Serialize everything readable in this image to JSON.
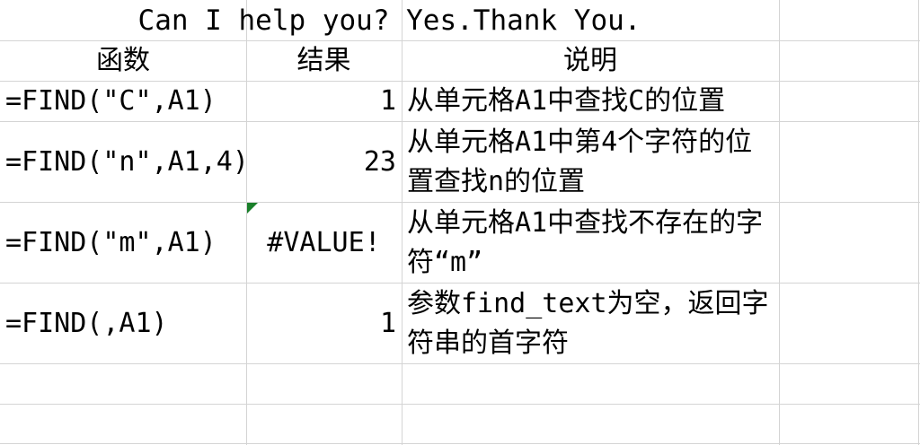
{
  "title": "Can I help you? Yes.Thank You.",
  "header": {
    "col_function": "函数",
    "col_result": "结果",
    "col_description": "说明"
  },
  "rows": [
    {
      "formula": "=FIND(\"C\",A1)",
      "result": "1",
      "description": "从单元格A1中查找C的位置"
    },
    {
      "formula": "=FIND(\"n\",A1,4)",
      "result": "23",
      "description": "从单元格A1中第4个字符的位置查找n的位置"
    },
    {
      "formula": "=FIND(\"m\",A1)",
      "result": "#VALUE!",
      "description": "从单元格A1中查找不存在的字符“m”"
    },
    {
      "formula": "=FIND(,A1)",
      "result": "1",
      "description": "参数find_text为空，返回字符串的首字符"
    }
  ],
  "colors": {
    "gridline": "#d4d4d4",
    "error_marker": "#1a7f2a"
  }
}
